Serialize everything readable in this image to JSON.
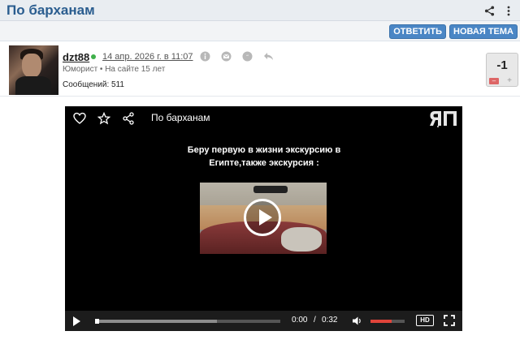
{
  "header": {
    "title": "По барханам"
  },
  "actions": {
    "reply": "ОТВЕТИТЬ",
    "new_topic": "НОВАЯ ТЕМА"
  },
  "post": {
    "username": "dzt88",
    "date": "14 апр. 2026 г. в 11:07",
    "rank_line": "Юморист • На сайте 15 лет",
    "messages": "Сообщений: 511",
    "rating": "-1"
  },
  "video": {
    "title": "По барханам",
    "caption": "Беру первую в жизни экскурсию в Египте,также экскурсия :",
    "time_current": "0:00",
    "time_separator": "/",
    "time_total": "0:32",
    "quality": "HD",
    "progress": 0.66,
    "volume": 0.62
  },
  "colors": {
    "accent": "#4a86c5",
    "title": "#2a5d8f",
    "volume": "#e0443a",
    "online": "#3fb04a"
  },
  "icons": [
    "share-icon",
    "more-icon",
    "info-icon",
    "mail-icon",
    "chat-icon",
    "reply-icon",
    "heart-icon",
    "star-icon",
    "play-icon",
    "volume-icon",
    "fullscreen-icon"
  ]
}
